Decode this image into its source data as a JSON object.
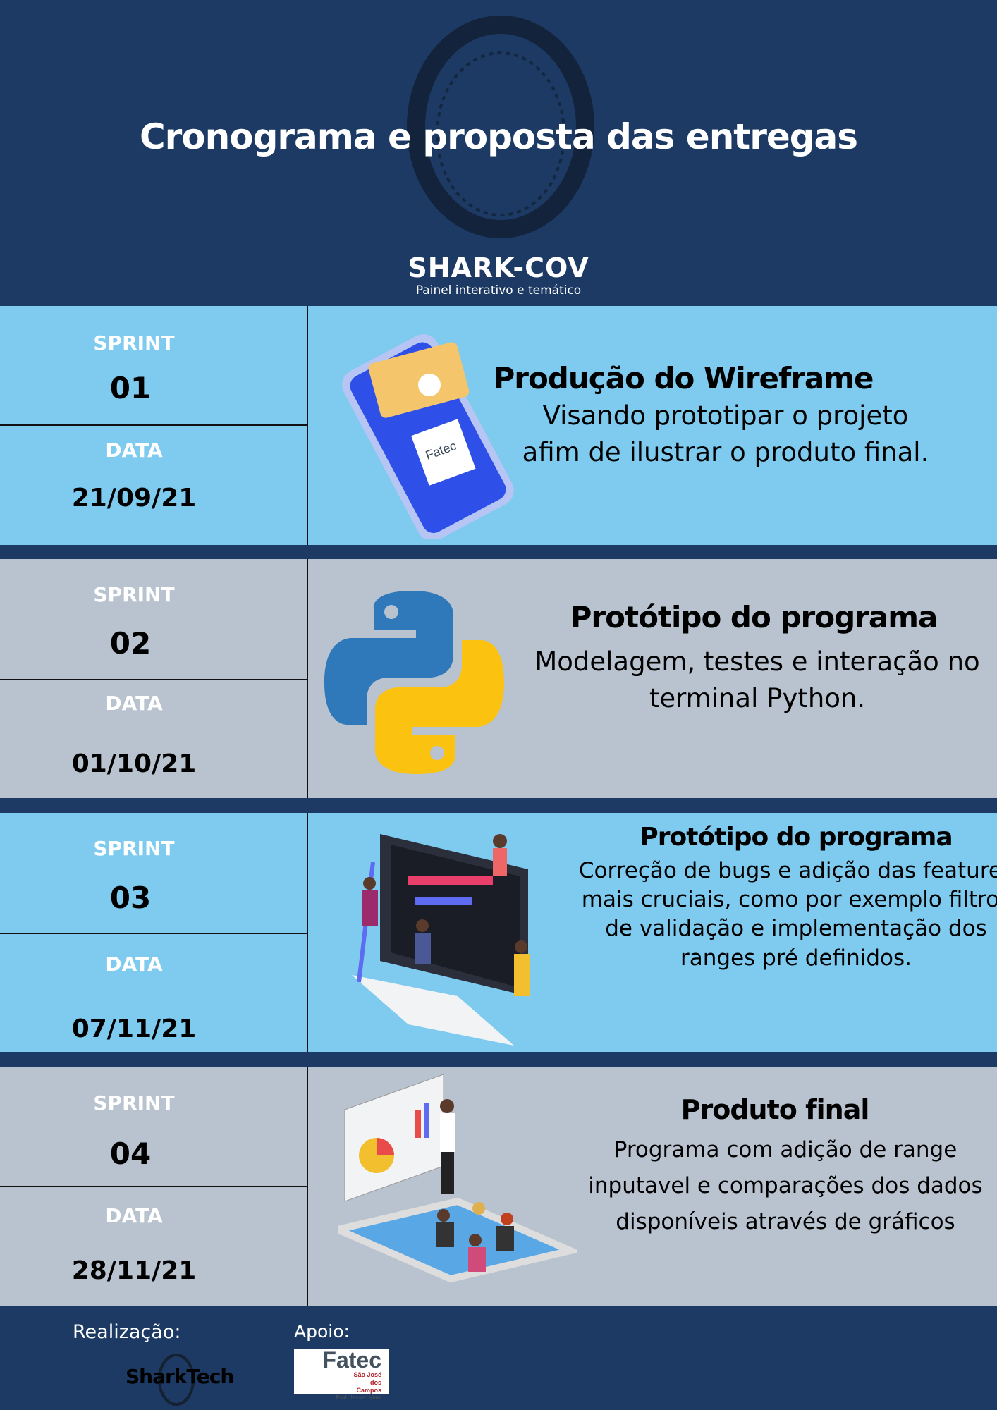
{
  "header": {
    "title": "Cronograma e proposta das entregas",
    "brand": "SHARK-COV",
    "subtitle": "Painel interativo e temático"
  },
  "labels": {
    "sprint": "SPRINT",
    "date": "DATA"
  },
  "sprints": [
    {
      "number": "01",
      "date": "21/09/21",
      "heading": "Produção do Wireframe",
      "description": "Visando prototipar o projeto afim de ilustrar o produto final.",
      "illustration": "phone-wireframe-icon",
      "badge": "Fatec",
      "badge_sub": "São José dos Campos"
    },
    {
      "number": "02",
      "date": "01/10/21",
      "heading": "Protótipo do programa",
      "description": "Modelagem, testes e interação no terminal Python.",
      "illustration": "python-logo-icon"
    },
    {
      "number": "03",
      "date": "07/11/21",
      "heading": "Protótipo do programa",
      "description": "Correção de bugs e adição das features mais cruciais, como por exemplo filtros de validação e implementação dos ranges pré definidos.",
      "illustration": "developers-screen-icon"
    },
    {
      "number": "04",
      "date": "28/11/21",
      "heading": "Produto final",
      "description": "Programa com adição de range inputavel e comparações dos dados disponíveis através de gráficos",
      "illustration": "presentation-team-icon"
    }
  ],
  "footer": {
    "realizacao": "Realização:",
    "apoio": "Apoio:",
    "sharktech": "SharkTech",
    "fatec": "Fatec",
    "fatec_city": "São José dos Campos",
    "fatec_prof": "Prof. Jessen Vidal"
  },
  "colors": {
    "navy": "#1c3a63",
    "light_blue": "#7ecbef",
    "gray": "#b9c3cf"
  }
}
